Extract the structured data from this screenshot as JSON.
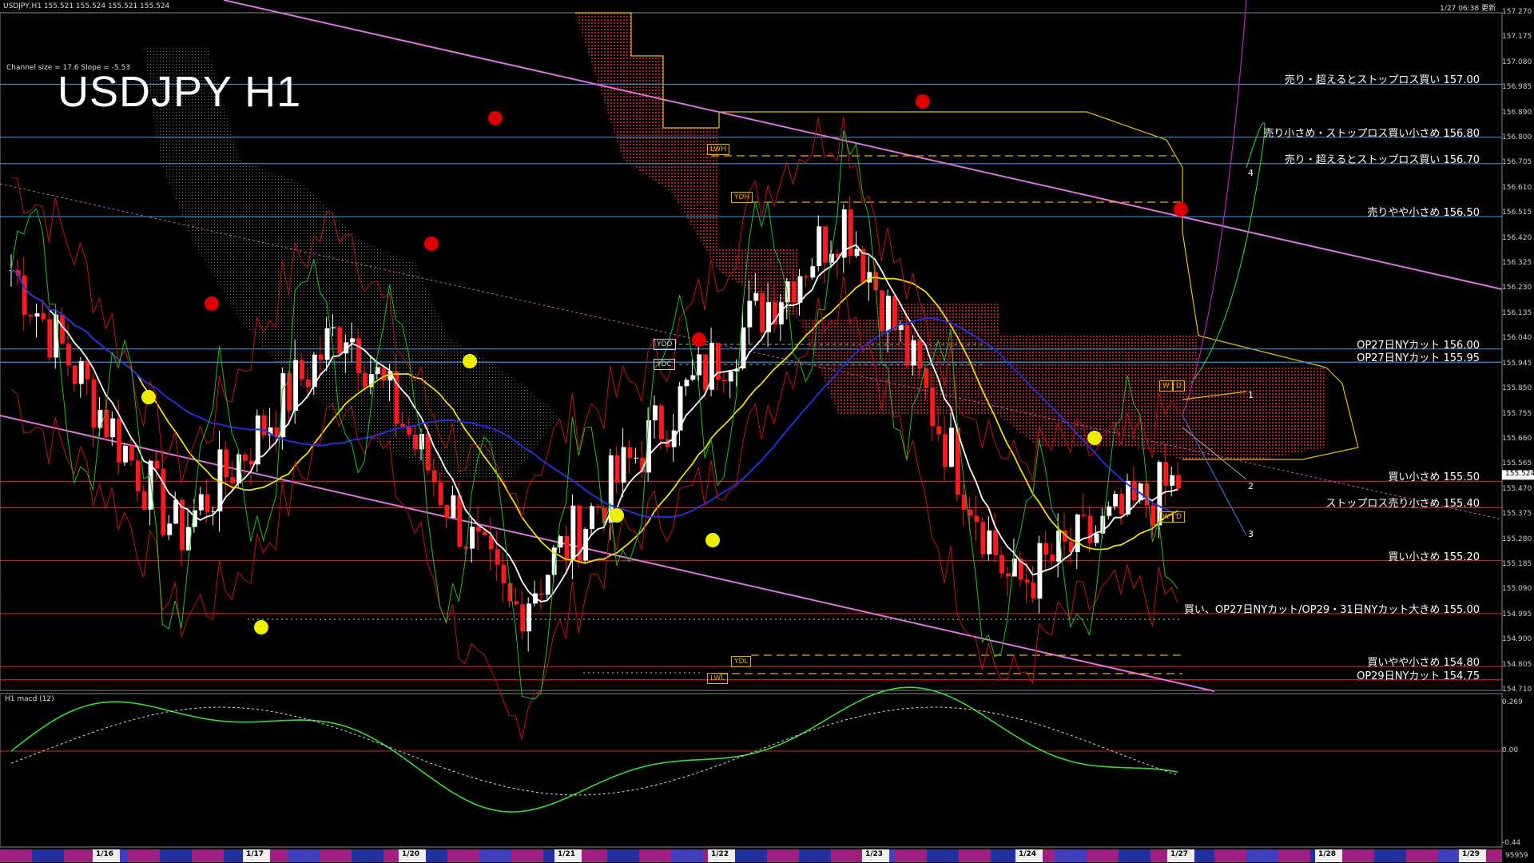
{
  "header": {
    "symbol_info": "USDJPY,H1  155.521 155.524 155.521 155.524",
    "timestamp": "1/27 06:38 更新"
  },
  "chart_title": "USDJPY H1",
  "channel_info": "Channel size = 17.6 Slope = -5.53",
  "price_levels": [
    {
      "price": "157.00",
      "label": "売り・超えるとストップロス買い 157.00",
      "color": "#3a8fd8"
    },
    {
      "price": "156.80",
      "label": "売り小さめ・ストップロス買い小さめ 156.80",
      "color": "#3a8fd8"
    },
    {
      "price": "156.70",
      "label": "売り・超えるとストップロス買い 156.70",
      "color": "#3a8fd8"
    },
    {
      "price": "156.50",
      "label": "売りやや小さめ 156.50",
      "color": "#3a8fd8"
    },
    {
      "price": "156.00",
      "label": "OP27日NYカット 156.00",
      "color": "#3a8fd8"
    },
    {
      "price": "155.95",
      "label": "OP27日NYカット 155.95",
      "color": "#3a8fd8"
    },
    {
      "price": "155.50",
      "label": "買い小さめ 155.50",
      "color": "#e02020"
    },
    {
      "price": "155.40",
      "label": "ストップロス売り小さめ 155.40",
      "color": "#e02020"
    },
    {
      "price": "155.20",
      "label": "買い小さめ 155.20",
      "color": "#e02020"
    },
    {
      "price": "155.00",
      "label": "買い、OP27日NYカット/OP29・31日NYカット大きめ 155.00",
      "color": "#e02020"
    },
    {
      "price": "154.80",
      "label": "買いやや小さめ 154.80",
      "color": "#e02020"
    },
    {
      "price": "154.75",
      "label": "OP29日NYカット 154.75",
      "color": "#e02020"
    }
  ],
  "price_axis_labels": [
    "157.270",
    "157.175",
    "157.080",
    "156.985",
    "156.890",
    "156.800",
    "156.705",
    "156.610",
    "156.515",
    "156.420",
    "156.325",
    "156.230",
    "156.135",
    "156.040",
    "155.945",
    "155.850",
    "155.755",
    "155.660",
    "155.565",
    "155.470",
    "155.375",
    "155.280",
    "155.185",
    "155.090",
    "154.995",
    "154.900",
    "154.805",
    "154.710"
  ],
  "current_price": "155.524",
  "markers": {
    "ydh": "YDH",
    "ydl": "YDL",
    "ydo": "YDO",
    "ydc": "YDC",
    "lwh": "LWH",
    "lwl": "LWL",
    "w": "W",
    "d": "D"
  },
  "projection_numbers": [
    "1",
    "2",
    "3",
    "4"
  ],
  "macd": {
    "title": "H1  macd (12)",
    "axis_labels": [
      "0.269",
      "0.00",
      "-0.44"
    ]
  },
  "date_labels": [
    "1/16",
    "1/17",
    "1/20",
    "1/21",
    "1/22",
    "1/23",
    "1/24",
    "1/27",
    "1/28",
    "1/29"
  ],
  "datebar_right": "95959",
  "colors": {
    "grid_blue": "#3a8fd8",
    "grid_red": "#e02020",
    "candle_up": "#ffffff",
    "candle_down": "#ff1a1a",
    "channel": "#e060e0",
    "cloud": "#cc3322"
  },
  "chart_data": {
    "type": "line",
    "title": "USDJPY H1",
    "ylim": [
      154.71,
      157.27
    ],
    "x": [
      "1/16",
      "1/17",
      "1/20",
      "1/21",
      "1/22",
      "1/23",
      "1/24",
      "1/27"
    ],
    "series": [
      {
        "name": "",
        "values": [
          156.3,
          155.3,
          156.1,
          155.0,
          155.8,
          156.5,
          155.1,
          155.5
        ]
      }
    ]
  }
}
